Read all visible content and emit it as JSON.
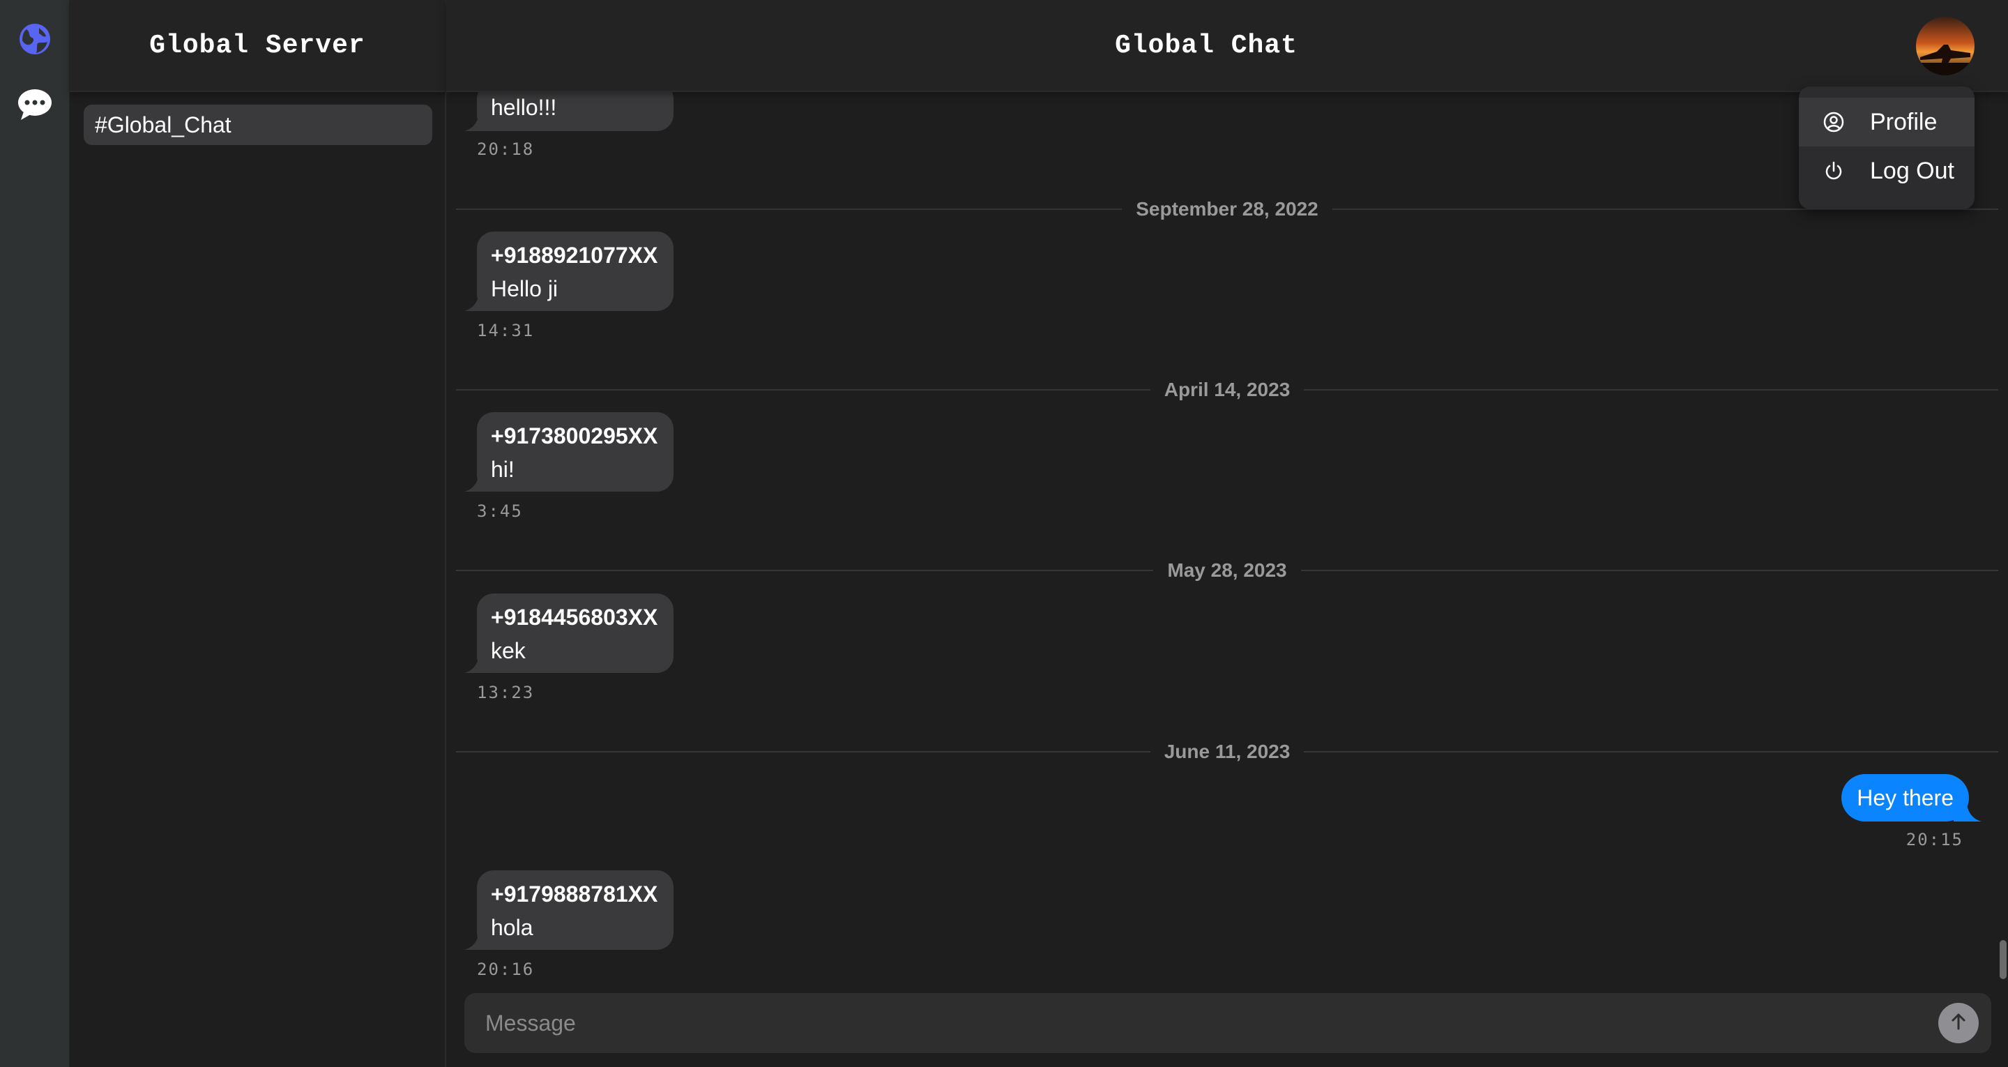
{
  "rail": {
    "items": [
      {
        "icon": "globe-icon",
        "active": true
      },
      {
        "icon": "chat-bubble-icon",
        "active": false
      }
    ]
  },
  "server": {
    "title": "Global Server",
    "channels": [
      "#Global_Chat"
    ]
  },
  "chat": {
    "title": "Global Chat",
    "avatar_icon": "user-avatar-sunset"
  },
  "menu": {
    "items": [
      {
        "label": "Profile",
        "icon": "user-circle-icon"
      },
      {
        "label": "Log Out",
        "icon": "power-icon"
      }
    ]
  },
  "messages": [
    {
      "type": "message",
      "sender": "",
      "text": "hello!!!",
      "time": "20:18"
    },
    {
      "type": "date",
      "label": "September 28, 2022"
    },
    {
      "type": "message",
      "sender": "+9188921077XX",
      "text": "Hello ji",
      "time": "14:31"
    },
    {
      "type": "date",
      "label": "April 14, 2023"
    },
    {
      "type": "message",
      "sender": "+9173800295XX",
      "text": "hi!",
      "time": "3:45"
    },
    {
      "type": "date",
      "label": "May 28, 2023"
    },
    {
      "type": "message",
      "sender": "+9184456803XX",
      "text": "kek",
      "time": "13:23"
    },
    {
      "type": "date",
      "label": "June 11, 2023"
    },
    {
      "type": "own",
      "text": "Hey there",
      "time": "20:15"
    },
    {
      "type": "message",
      "sender": "+9179888781XX",
      "text": "hola",
      "time": "20:16"
    }
  ],
  "composer": {
    "placeholder": "Message",
    "send_icon": "arrow-up-icon"
  },
  "colors": {
    "accent": "#0a84ff",
    "bubble": "#3a3a3c",
    "background": "#1e1e1e",
    "rail": "#2f3233",
    "globe": "#5865f2"
  }
}
